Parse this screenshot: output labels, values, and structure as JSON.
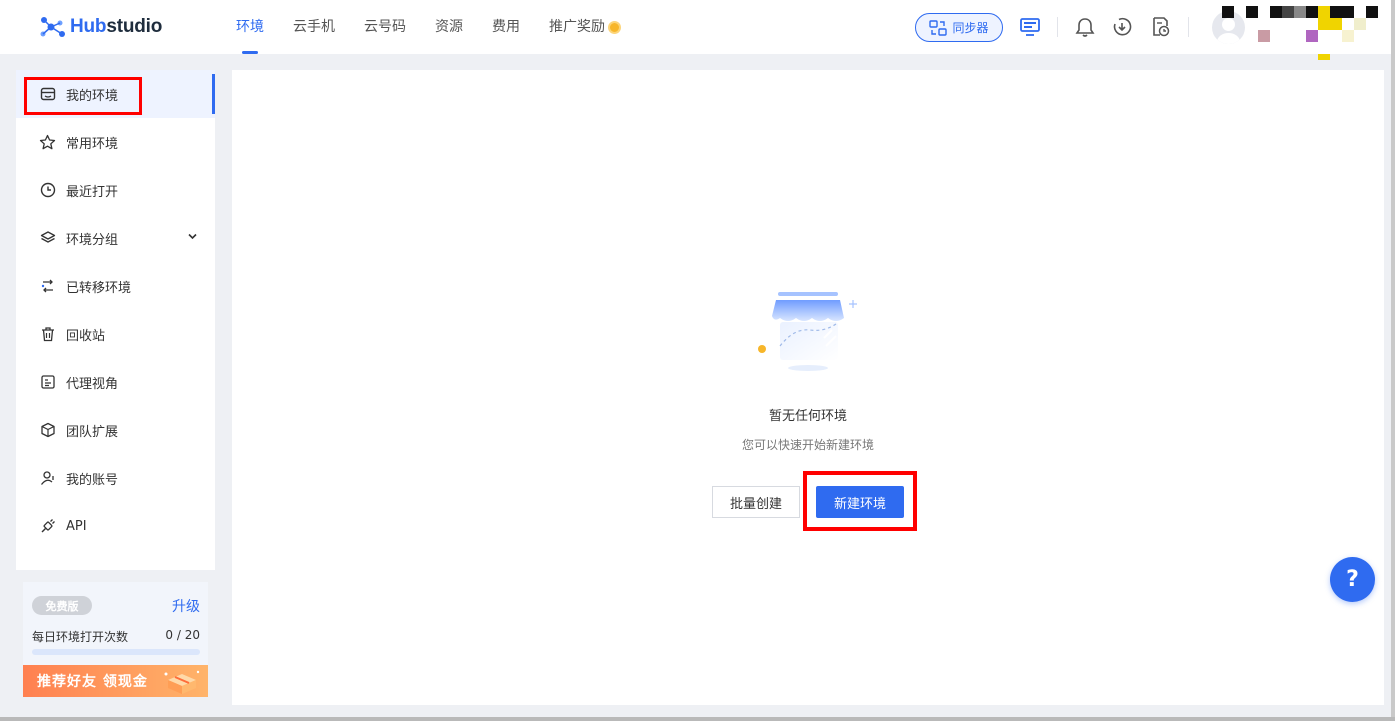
{
  "app": {
    "logo_prefix": "Hub",
    "logo_suffix": "studio"
  },
  "topnav": {
    "items": [
      {
        "label": "环境",
        "active": true
      },
      {
        "label": "云手机",
        "active": false
      },
      {
        "label": "云号码",
        "active": false
      },
      {
        "label": "资源",
        "active": false
      },
      {
        "label": "费用",
        "active": false
      },
      {
        "label": "推广奖励",
        "active": false,
        "badge_icon": "coin-icon"
      }
    ],
    "sync_button_label": "同步器",
    "icons": [
      "screen-sync-icon",
      "bell-icon",
      "download-refresh-icon",
      "file-clock-icon"
    ]
  },
  "sidebar": {
    "items": [
      {
        "label": "我的环境",
        "icon": "store-icon",
        "active": true
      },
      {
        "label": "常用环境",
        "icon": "star-icon",
        "active": false
      },
      {
        "label": "最近打开",
        "icon": "clock-icon",
        "active": false
      },
      {
        "label": "环境分组",
        "icon": "layers-icon",
        "active": false,
        "expandable": true
      },
      {
        "label": "已转移环境",
        "icon": "transfer-icon",
        "active": false
      },
      {
        "label": "回收站",
        "icon": "trash-icon",
        "active": false
      },
      {
        "label": "代理视角",
        "icon": "proxy-view-icon",
        "active": false
      },
      {
        "label": "团队扩展",
        "icon": "cube-icon",
        "active": false
      },
      {
        "label": "我的账号",
        "icon": "user-icon",
        "active": false
      },
      {
        "label": "API",
        "icon": "plug-icon",
        "active": false
      }
    ]
  },
  "plan": {
    "badge": "免费版",
    "upgrade_label": "升级",
    "daily_label": "每日环境打开次数",
    "daily_value": "0 / 20",
    "daily_progress": 0,
    "promo_label": "推荐好友 领现金"
  },
  "main": {
    "empty_title": "暂无任何环境",
    "empty_subtitle": "您可以快速开始新建环境",
    "batch_create_label": "批量创建",
    "new_env_label": "新建环境"
  },
  "help": {
    "label": "?"
  },
  "colors": {
    "accent": "#2f6bf0",
    "highlight_box": "#ff0000",
    "promo_start": "#ff8050",
    "promo_end": "#ffb46a"
  }
}
